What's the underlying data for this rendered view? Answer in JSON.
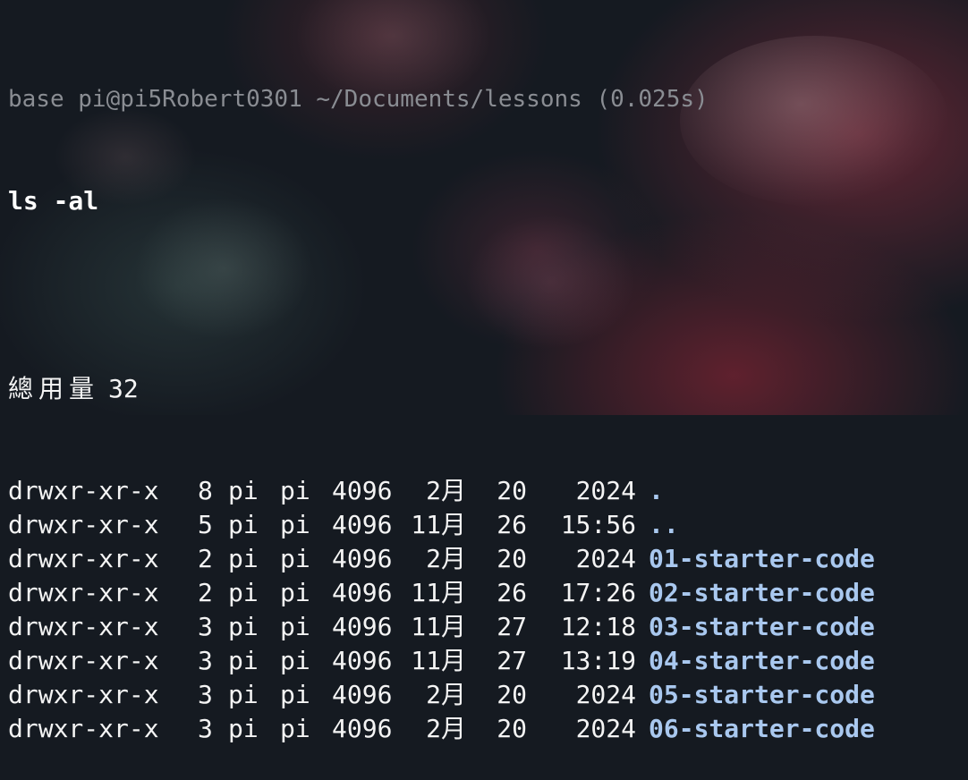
{
  "theme": {
    "background": "#151a21",
    "prompt_color": "#8a8d93",
    "dir_color": "#a9c8ef",
    "text_color": "#f4f4f4"
  },
  "prompt": {
    "text": "base pi@pi5Robert0301 ~/Documents/lessons (0.025s)"
  },
  "command": {
    "text": "ls -al"
  },
  "output": {
    "total_label": "總用量",
    "total_value": "32",
    "rows": [
      {
        "perm": "drwxr-xr-x",
        "links": "8",
        "user": "pi",
        "group": "pi",
        "size": "4096",
        "month": "2月",
        "day": "20",
        "time": "2024",
        "name": "."
      },
      {
        "perm": "drwxr-xr-x",
        "links": "5",
        "user": "pi",
        "group": "pi",
        "size": "4096",
        "month": "11月",
        "day": "26",
        "time": "15:56",
        "name": ".."
      },
      {
        "perm": "drwxr-xr-x",
        "links": "2",
        "user": "pi",
        "group": "pi",
        "size": "4096",
        "month": "2月",
        "day": "20",
        "time": "2024",
        "name": "01-starter-code"
      },
      {
        "perm": "drwxr-xr-x",
        "links": "2",
        "user": "pi",
        "group": "pi",
        "size": "4096",
        "month": "11月",
        "day": "26",
        "time": "17:26",
        "name": "02-starter-code"
      },
      {
        "perm": "drwxr-xr-x",
        "links": "3",
        "user": "pi",
        "group": "pi",
        "size": "4096",
        "month": "11月",
        "day": "27",
        "time": "12:18",
        "name": "03-starter-code"
      },
      {
        "perm": "drwxr-xr-x",
        "links": "3",
        "user": "pi",
        "group": "pi",
        "size": "4096",
        "month": "11月",
        "day": "27",
        "time": "13:19",
        "name": "04-starter-code"
      },
      {
        "perm": "drwxr-xr-x",
        "links": "3",
        "user": "pi",
        "group": "pi",
        "size": "4096",
        "month": "2月",
        "day": "20",
        "time": "2024",
        "name": "05-starter-code"
      },
      {
        "perm": "drwxr-xr-x",
        "links": "3",
        "user": "pi",
        "group": "pi",
        "size": "4096",
        "month": "2月",
        "day": "20",
        "time": "2024",
        "name": "06-starter-code"
      }
    ]
  }
}
